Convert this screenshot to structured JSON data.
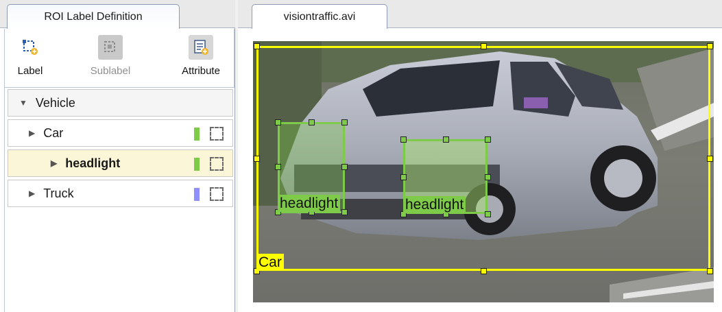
{
  "left_panel": {
    "tab_title": "ROI Label Definition",
    "toolbar": {
      "label": "Label",
      "sublabel": "Sublabel",
      "attribute": "Attribute"
    },
    "tree": [
      {
        "name": "Vehicle",
        "expanded": true
      },
      {
        "name": "Car",
        "color": "#7ecb4a"
      },
      {
        "name": "headlight",
        "color": "#7ecb4a",
        "selected": true
      },
      {
        "name": "Truck",
        "color": "#8f8fff"
      }
    ]
  },
  "right_panel": {
    "tab_title": "visiontraffic.avi",
    "rois": {
      "car": {
        "label": "Car",
        "color": "#ffff00"
      },
      "headlight_1": {
        "label": "headlight",
        "color": "#7ecb4a"
      },
      "headlight_2": {
        "label": "headlight",
        "color": "#7ecb4a"
      }
    }
  }
}
